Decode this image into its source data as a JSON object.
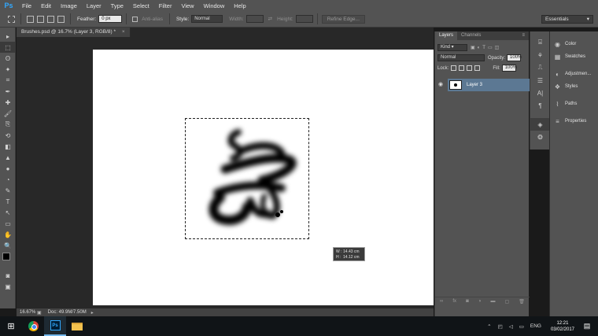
{
  "app": {
    "logo": "Ps"
  },
  "menu": [
    "File",
    "Edit",
    "Image",
    "Layer",
    "Type",
    "Select",
    "Filter",
    "View",
    "Window",
    "Help"
  ],
  "options": {
    "feather_label": "Feather:",
    "feather_value": "0 px",
    "antialias_label": "Anti-alias",
    "style_label": "Style:",
    "style_value": "Normal",
    "width_label": "Width:",
    "height_label": "Height:",
    "refine_edge": "Refine Edge...",
    "workspace": "Essentials"
  },
  "tools": [
    "▸",
    "⬚",
    "ʘ",
    "✦",
    "⌗",
    "✒",
    "✚",
    "🖌",
    "⎘",
    "⟲",
    "◧",
    "▲",
    "●",
    "◔",
    "✎",
    "T",
    "↖",
    "▭",
    "✋",
    "🔍"
  ],
  "document": {
    "tab_title": "Brushes.psd @ 16.7% (Layer 3, RGB/8) *",
    "tab_close": "×",
    "tooltip": {
      "w_label": "W :",
      "w_value": "14.43 cm",
      "h_label": "H :",
      "h_value": "14.12 cm"
    }
  },
  "status": {
    "zoom": "16.67%",
    "doc": "Doc: 49.9M/7.50M"
  },
  "layers_panel": {
    "tab_layers": "Layers",
    "tab_channels": "Channels",
    "filter_kind": "Kind",
    "blend_mode": "Normal",
    "opacity_label": "Opacity:",
    "opacity_value": "100%",
    "lock_label": "Lock:",
    "fill_label": "Fill:",
    "fill_value": "100%",
    "layer_name": "Layer 3",
    "footer_icons": [
      "∞",
      "fx",
      "◙",
      "◑",
      "▬",
      "▢",
      "🗑"
    ]
  },
  "right_panel": {
    "items": [
      {
        "icon": "◉",
        "label": "Color"
      },
      {
        "icon": "▦",
        "label": "Swatches"
      },
      {
        "icon": "◐",
        "label": "Adjustmen..."
      },
      {
        "icon": "❖",
        "label": "Styles"
      },
      {
        "icon": "⌇",
        "label": "Paths"
      },
      {
        "icon": "≡",
        "label": "Properties"
      }
    ]
  },
  "taskbar": {
    "language": "ENG",
    "time": "12:21",
    "date": "03/02/2017"
  }
}
